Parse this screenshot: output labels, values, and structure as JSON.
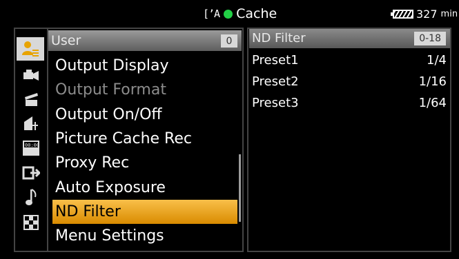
{
  "status": {
    "mode_label": "Cache",
    "battery_minutes": "327",
    "battery_unit": "min"
  },
  "menu": {
    "header_title": "User",
    "page_number": "0",
    "items": [
      {
        "label": "Output Display",
        "state": "normal"
      },
      {
        "label": "Output Format",
        "state": "disabled"
      },
      {
        "label": "Output On/Off",
        "state": "normal"
      },
      {
        "label": "Picture Cache Rec",
        "state": "normal"
      },
      {
        "label": "Proxy Rec",
        "state": "normal"
      },
      {
        "label": "Auto Exposure",
        "state": "normal"
      },
      {
        "label": "ND Filter",
        "state": "selected"
      },
      {
        "label": "Menu Settings",
        "state": "normal"
      }
    ]
  },
  "detail": {
    "title": "ND Filter",
    "range": "0-18",
    "presets": [
      {
        "name": "Preset1",
        "value": "1/4"
      },
      {
        "name": "Preset2",
        "value": "1/16"
      },
      {
        "name": "Preset3",
        "value": "1/64"
      }
    ]
  },
  "icons": [
    {
      "name": "user-menu-icon"
    },
    {
      "name": "camera-icon"
    },
    {
      "name": "clapper-icon"
    },
    {
      "name": "paint-icon"
    },
    {
      "name": "timecode-icon"
    },
    {
      "name": "output-icon"
    },
    {
      "name": "audio-icon"
    },
    {
      "name": "maintenance-icon"
    }
  ],
  "colors": {
    "selected_bg": "#f0a820",
    "tally_green": "#22d046"
  }
}
